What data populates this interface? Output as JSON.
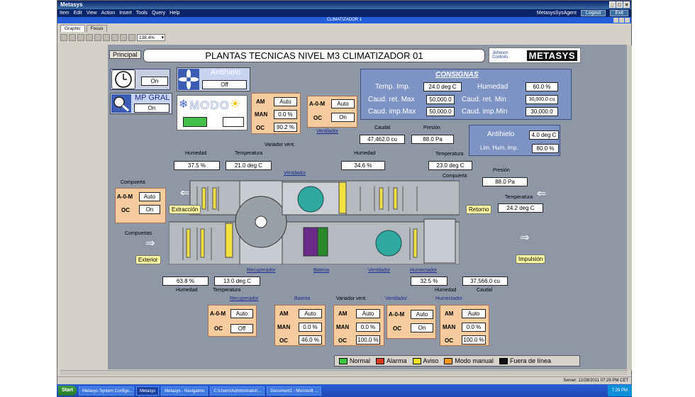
{
  "window": {
    "title": "Metasys",
    "sub_title": "CLIMATIZADOR 1"
  },
  "menu": {
    "items": [
      "Item",
      "Edit",
      "View",
      "Action",
      "Insert",
      "Tools",
      "Query",
      "Help"
    ],
    "agent": "MetasysSysAgent",
    "logout": "Logout",
    "exit": "Exit"
  },
  "tabs": [
    "Graphic",
    "Focus"
  ],
  "toolbar": {
    "zoom": "138.4%"
  },
  "header": {
    "principal": "Principal",
    "title": "PLANTAS TECNICAS NIVEL M3 CLIMATIZADOR 01",
    "jc_logo": "Johnson Controls",
    "brand": "METASYS"
  },
  "top_left": {
    "clock_value": "On",
    "antihielo_label": "Antihielo",
    "antihielo_value": "Off",
    "mp_label": "MP GRAL",
    "mp_value": "On",
    "modo_label": "MODO"
  },
  "consignas": {
    "title": "CONSIGNAS",
    "temp_imp_label": "Temp. Imp.",
    "temp_imp": "24.0 deg C",
    "humedad_label": "Humedad",
    "humedad": "60.0 %",
    "caud_ret_max_label": "Caud. ret. Max",
    "caud_ret_max": "50,000.0",
    "caud_ret_min_label": "Caud. ret. Min",
    "caud_ret_min": "30,000.0 cu",
    "caud_imp_max_label": "Caud. imp.Max",
    "caud_imp_max": "50,000.0",
    "caud_imp_min_label": "Caud. imp.Min",
    "caud_imp_min": "30,000.0"
  },
  "antihielo_panel": {
    "label": "Antihielo",
    "value": "4.0 deg C",
    "lim_label": "Lim. Hum. imp.",
    "lim_value": "80.0 %"
  },
  "var_vent_top": {
    "am": "AM",
    "am_val": "Auto",
    "man": "MAN",
    "man_val": "0.0 %",
    "oc": "OC",
    "oc_val": "90.2 %",
    "caption": "Variador vent."
  },
  "vent_top": {
    "aom": "A-0-M",
    "aom_val": "Auto",
    "oc": "OC",
    "oc_val": "On",
    "caption": "Ventilador"
  },
  "upper_readings": {
    "caudal_label": "Caudal",
    "caudal": "47,462.0 cu",
    "presion_label": "Presión",
    "presion": "88.0 Pa",
    "humedad_label": "Humedad",
    "humedad": "34.6 %",
    "temperatura_label": "Temperatura",
    "temperatura": "23.0 deg C",
    "humedad_left_label": "Humedad",
    "humedad_left": "37.5 %",
    "temp_left_label": "Temperatura",
    "temp_left": "21.0 deg C",
    "presion2_label": "Presión",
    "presion2": "88.0 Pa",
    "temp_ret_label": "Temperatura",
    "temp_ret": "24.2 deg C",
    "compuerta_r": "Compuerta"
  },
  "compuerta_left": {
    "label": "Compuerta",
    "aom": "A-0-M",
    "aom_val": "Auto",
    "oc": "OC",
    "oc_val": "On"
  },
  "tags": {
    "extraccion": "Extracción",
    "retorno": "Retorno",
    "exterior": "Exterior",
    "impulsion": "Impulsión",
    "compuertas": "Compuertas",
    "ventilador_mid": "Ventilador"
  },
  "lower_readings": {
    "humedad": "63.8 %",
    "humedad_label": "Humedad",
    "temperatura": "13.0 deg C",
    "temperatura_label": "Temperatura",
    "hum2": "32.5 %",
    "hum2_label": "Humedad",
    "caudal": "37,566.0 cu",
    "caudal_label": "Caudal",
    "recuperador": "Recuperador",
    "bateria": "Bateria",
    "ventilador": "Ventilador",
    "humectador": "Humectador"
  },
  "bottom_panels": {
    "recuperador": {
      "caption": "Recuperador",
      "aom": "A-0-M",
      "aom_val": "Auto",
      "oc": "OC",
      "oc_val": "Off"
    },
    "bateria": {
      "caption": "Bateria",
      "am": "AM",
      "am_val": "Auto",
      "man": "MAN",
      "man_val": "0.0 %",
      "oc": "OC",
      "oc_val": "46.0 %"
    },
    "variador": {
      "caption": "Variador vent.",
      "am": "AM",
      "am_val": "Auto",
      "man": "MAN",
      "man_val": "0.0 %",
      "oc": "OC",
      "oc_val": "100.0 %"
    },
    "ventilador": {
      "caption": "Ventilador",
      "aom": "A-0-M",
      "aom_val": "Auto",
      "oc": "OC",
      "oc_val": "On"
    },
    "humectador": {
      "caption": "Humectador",
      "am": "AM",
      "am_val": "Auto",
      "man": "MAN",
      "man_val": "0.0 %",
      "oc": "OC",
      "oc_val": "100.0 %"
    }
  },
  "legend": [
    {
      "label": "Normal",
      "color": "#3cc83c"
    },
    {
      "label": "Alarma",
      "color": "#e03a1e"
    },
    {
      "label": "Aviso",
      "color": "#f2e21e"
    },
    {
      "label": "Modo manual",
      "color": "#f29a1e"
    },
    {
      "label": "Fuera de línea",
      "color": "#111111"
    }
  ],
  "status": "Server: 12/28/2011 07:28 PM CET",
  "taskbar": {
    "start": "Start",
    "items": [
      "Metasys System Configu...",
      "Metasys",
      "Metasys - Navigation",
      "C:\\Users\\Administrator\\...",
      "Document1 - Microsoft ..."
    ],
    "clock": "7:29 PM"
  }
}
